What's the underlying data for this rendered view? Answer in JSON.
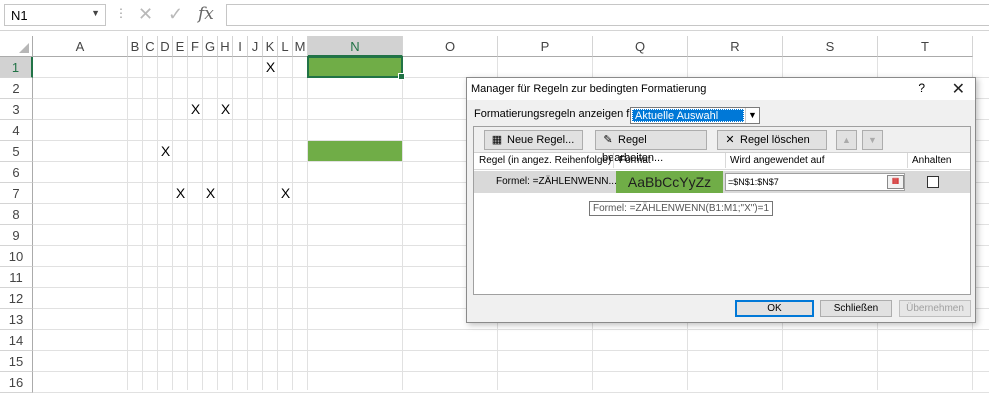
{
  "formula_bar": {
    "name_box": "N1",
    "name_box_arrow": "▼",
    "separator": "⋮",
    "cancel_glyph": "✕",
    "enter_glyph": "✓",
    "fx_label": "fx",
    "formula": ""
  },
  "grid": {
    "columns": [
      "A",
      "B",
      "C",
      "D",
      "E",
      "F",
      "G",
      "H",
      "I",
      "J",
      "K",
      "L",
      "M",
      "N",
      "O",
      "P",
      "Q",
      "R",
      "S",
      "T"
    ],
    "selected_column": "N",
    "rows": [
      "1",
      "2",
      "3",
      "4",
      "5",
      "6",
      "7",
      "8",
      "9",
      "10",
      "11",
      "12",
      "13",
      "14",
      "15",
      "16"
    ],
    "selected_row": "1",
    "cells": {
      "K1": "X",
      "F3": "X",
      "H3": "X",
      "D5": "X",
      "E7": "X",
      "G7": "X",
      "L7": "X"
    },
    "highlight_color": "#70ad47"
  },
  "dialog": {
    "title": "Manager für Regeln zur bedingten Formatierung",
    "help_label": "?",
    "close_label": "✕",
    "show_rules_label": "Formatierungsregeln anzeigen für:",
    "show_rules_value": "Aktuelle Auswahl",
    "toolbar": {
      "new_rule": "Neue Regel...",
      "edit_rule": "Regel bearbeiten...",
      "delete_rule": "Regel löschen",
      "move_up": "▲",
      "move_down": "▼"
    },
    "columns": {
      "rule": "Regel (in angez. Reihenfolge)",
      "format": "Format",
      "applies_to": "Wird angewendet auf",
      "stop": "Anhalten"
    },
    "rules": [
      {
        "rule": "Formel: =ZÄHLENWENN...",
        "format_preview": "AaBbCcYyZz",
        "applies_to": "=$N$1:$N$7",
        "stop_if_true": false
      }
    ],
    "tooltip": "Formel: =ZÄHLENWENN(B1:M1;\"X\")=1",
    "buttons": {
      "ok": "OK",
      "close": "Schließen",
      "apply": "Übernehmen"
    }
  }
}
